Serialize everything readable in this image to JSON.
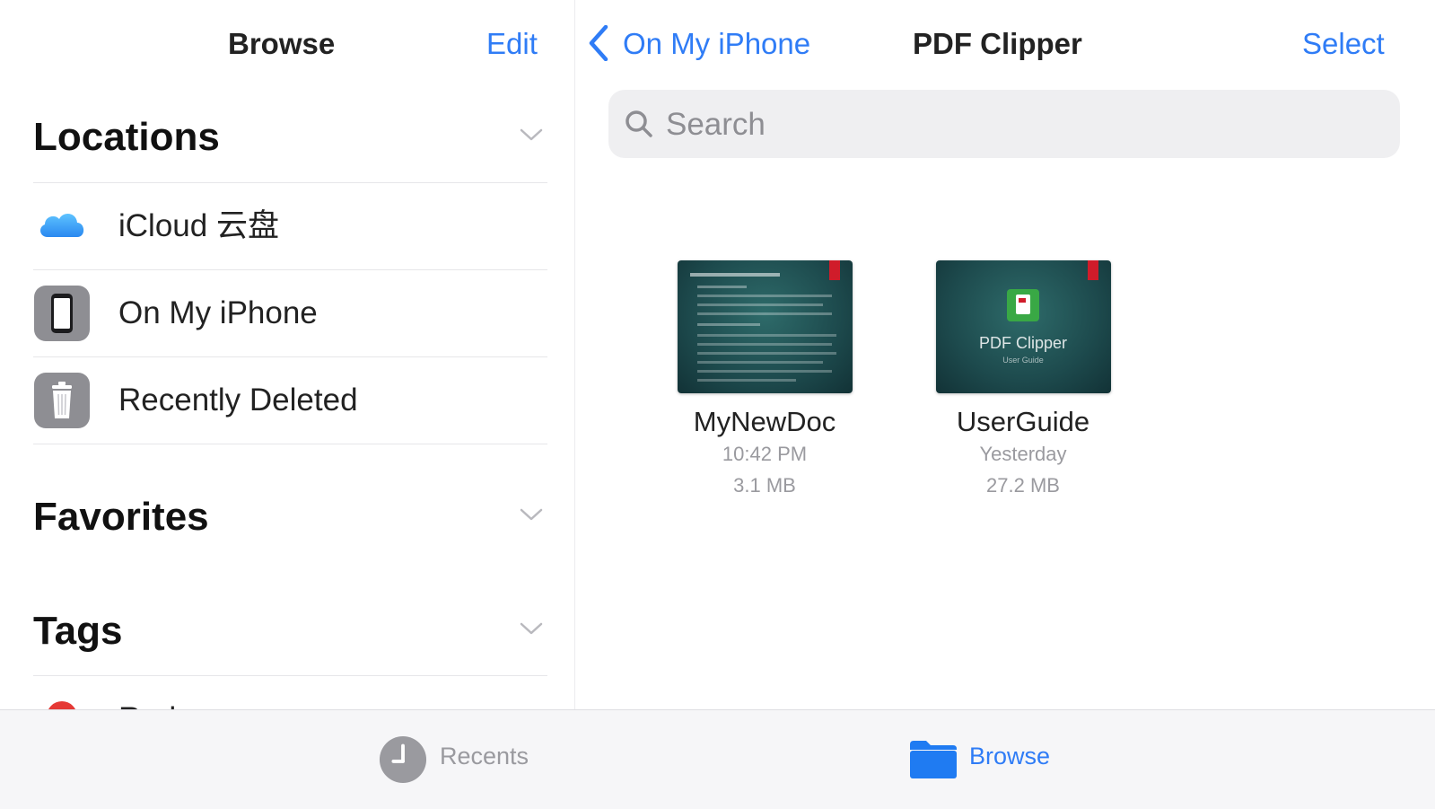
{
  "sidebar": {
    "title": "Browse",
    "edit_label": "Edit",
    "sections": {
      "locations": "Locations",
      "favorites": "Favorites",
      "tags": "Tags"
    },
    "locations": [
      {
        "label": "iCloud 云盘",
        "icon": "icloud-icon"
      },
      {
        "label": "On My iPhone",
        "icon": "iphone-icon"
      },
      {
        "label": "Recently Deleted",
        "icon": "trash-icon"
      }
    ],
    "tags_first_item": "Red"
  },
  "main": {
    "back_label": "On My iPhone",
    "title": "PDF Clipper",
    "select_label": "Select",
    "search": {
      "placeholder": "Search"
    },
    "files": [
      {
        "name": "MyNewDoc",
        "date": "10:42 PM",
        "size": "3.1 MB"
      },
      {
        "name": "UserGuide",
        "date": "Yesterday",
        "size": "27.2 MB",
        "thumb_title": "PDF Clipper",
        "thumb_subtitle": "User Guide"
      }
    ]
  },
  "tabbar": {
    "recents": "Recents",
    "browse": "Browse"
  },
  "colors": {
    "accent": "#2f7cf6",
    "tag_red": "#e53935",
    "inactive": "#9a9a9f"
  }
}
